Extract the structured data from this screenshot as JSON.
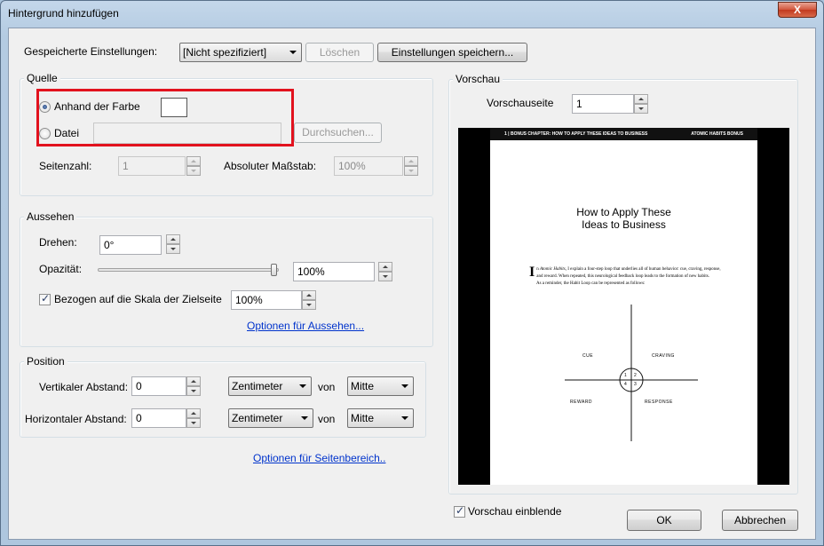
{
  "window": {
    "title": "Hintergrund hinzufügen",
    "close_glyph": "X"
  },
  "saved_settings": {
    "label": "Gespeicherte Einstellungen:",
    "value": "[Nicht spezifiziert]",
    "delete_label": "Löschen",
    "save_label": "Einstellungen speichern..."
  },
  "source": {
    "group_label": "Quelle",
    "by_color_label": "Anhand der Farbe",
    "file_label": "Datei",
    "file_value": "",
    "browse_label": "Durchsuchen...",
    "page_number_label": "Seitenzahl:",
    "page_number_value": "1",
    "absolute_scale_label": "Absoluter Maßstab:",
    "absolute_scale_value": "100%",
    "selected_color": "#ffffff"
  },
  "appearance": {
    "group_label": "Aussehen",
    "rotate_label": "Drehen:",
    "rotate_value": "0°",
    "opacity_label": "Opazität:",
    "opacity_value": "100%",
    "opacity_fraction": 1.0,
    "relative_scale_label": "Bezogen auf die Skala der Zielseite",
    "relative_scale_value": "100%",
    "options_link": "Optionen für Aussehen..."
  },
  "position": {
    "group_label": "Position",
    "vertical_label": "Vertikaler Abstand:",
    "vertical_value": "0",
    "vertical_unit": "Zentimeter",
    "vertical_from_label": "von",
    "vertical_from": "Mitte",
    "horizontal_label": "Horizontaler Abstand:",
    "horizontal_value": "0",
    "horizontal_unit": "Zentimeter",
    "horizontal_from_label": "von",
    "horizontal_from": "Mitte"
  },
  "page_range_link": "Optionen für Seitenbereich..",
  "preview": {
    "group_label": "Vorschau",
    "page_label": "Vorschauseite",
    "page_value": "1",
    "show_preview_label": "Vorschau einblende",
    "page": {
      "header_left": "1 | BONUS CHAPTER: HOW TO APPLY THESE IDEAS TO BUSINESS",
      "header_right": "ATOMIC HABITS BONUS",
      "title_line1": "How to Apply These",
      "title_line2": "Ideas to Business",
      "dropcap": "I",
      "body_intro": "n ",
      "body_italic": "Atomic Habits",
      "body_p1": ", I explain a four-step loop that underlies all of human behavior: cue, craving, response, and reward. When repeated, this neurological feedback loop leads to the formation of new habits.",
      "body_p2": "As a reminder, the Habit Loop can be represented as follows:",
      "diagram": {
        "cue": "CUE",
        "craving": "CRAVING",
        "reward": "REWARD",
        "response": "RESPONSE",
        "q1": "1",
        "q2": "2",
        "q3": "3",
        "q4": "4"
      }
    }
  },
  "buttons": {
    "ok": "OK",
    "cancel": "Abbrechen"
  },
  "colors": {
    "highlight": "#e2121e",
    "link": "#0033cc"
  }
}
